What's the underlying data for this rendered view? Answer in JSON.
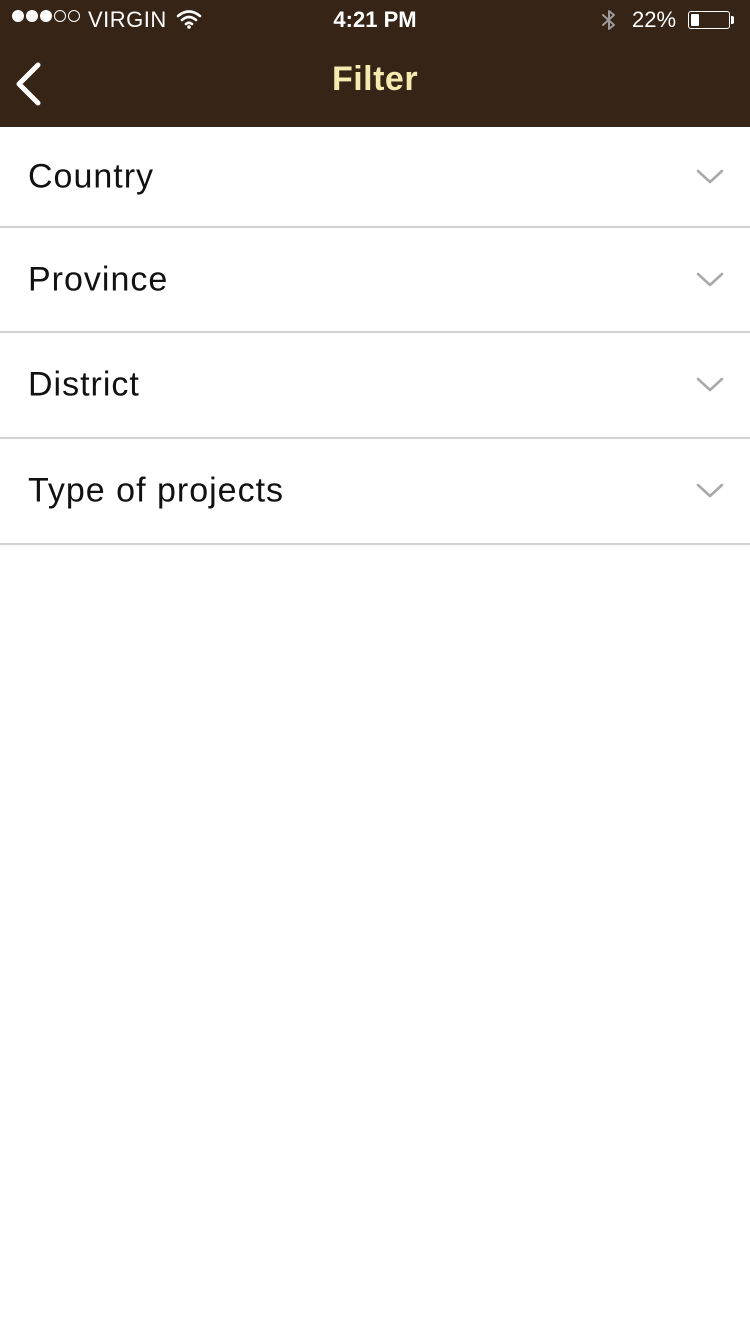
{
  "status_bar": {
    "carrier": "VIRGIN",
    "time": "4:21 PM",
    "battery_percent": "22%",
    "battery_level": 0.22,
    "signal_strength": 3,
    "signal_max": 5
  },
  "nav": {
    "title": "Filter",
    "back_icon": "chevron-left-icon"
  },
  "filters": [
    {
      "label": "Country",
      "icon": "chevron-down-icon"
    },
    {
      "label": "Province",
      "icon": "chevron-down-icon"
    },
    {
      "label": "District",
      "icon": "chevron-down-icon"
    },
    {
      "label": "Type of projects",
      "icon": "chevron-down-icon"
    }
  ],
  "colors": {
    "nav_background": "#362416",
    "nav_title": "#f5eab0",
    "chevron": "#a9a9a9"
  }
}
